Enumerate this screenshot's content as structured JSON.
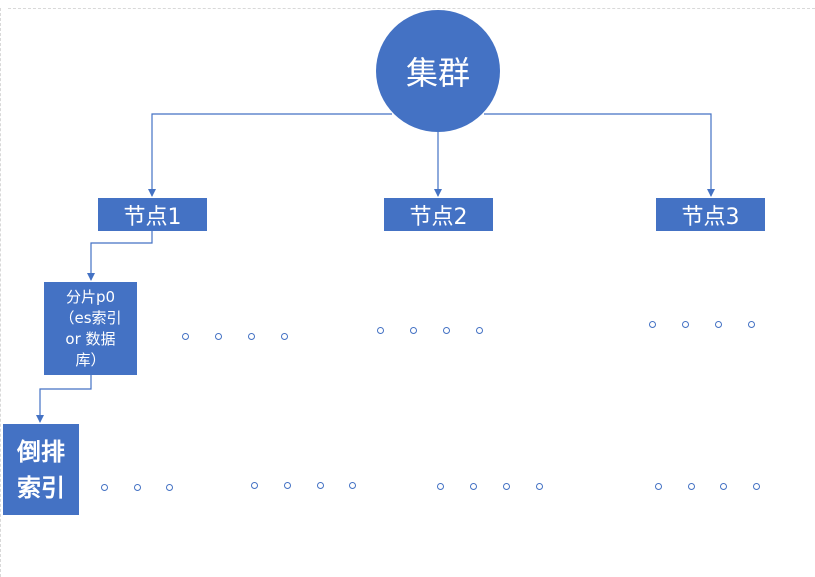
{
  "diagram": {
    "cluster": {
      "label": "集群"
    },
    "hosts": [
      {
        "label": "节点1"
      },
      {
        "label": "节点2"
      },
      {
        "label": "节点3"
      }
    ],
    "shard": {
      "label": "分片p0\n（es索引\nor 数据\n库）"
    },
    "inverted_index": {
      "label": "倒排\n索引"
    }
  },
  "colors": {
    "node_fill": "#4472c4",
    "connector": "#4472c4",
    "node_text": "#ffffff"
  }
}
